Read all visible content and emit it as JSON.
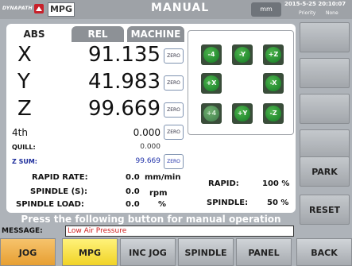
{
  "topbar": {
    "logo_text": "DYNAPATH",
    "mode_button": "MPG",
    "title": "MANUAL",
    "unit": "mm",
    "datetime": "2015-5-25 20:10:07",
    "priority": "Priority",
    "none": "None"
  },
  "tabs": {
    "abs": "ABS",
    "rel": "REL",
    "machine": "MACHINE"
  },
  "axes": {
    "x": {
      "label": "X",
      "value": "91.135"
    },
    "y": {
      "label": "Y",
      "value": "41.983"
    },
    "z": {
      "label": "Z",
      "value": "99.669"
    },
    "fourth": {
      "label": "4th",
      "value": "0.000"
    },
    "quill": {
      "label": "QUILL:",
      "value": "0.000"
    },
    "zsum": {
      "label": "Z SUM:",
      "value": "99.669"
    }
  },
  "zero_label": "ZERO",
  "rates": {
    "rapid_rate_label": "RAPID RATE:",
    "rapid_rate_value": "0.0",
    "rapid_rate_unit": "mm/min",
    "spindle_s_label": "SPINDLE (S):",
    "spindle_s_value": "0.0",
    "spindle_s_unit": "rpm",
    "spindle_load_label": "SPINDLE LOAD:",
    "spindle_load_value": "0.0",
    "spindle_load_unit": "%",
    "rapid_label": "RAPID:",
    "rapid_value": "100 %",
    "spindle_label": "SPINDLE:",
    "spindle_value": "50 %"
  },
  "jog_buttons": {
    "minus4": "-4",
    "minusY": "-Y",
    "plusZ": "+Z",
    "plusX": "+X",
    "minusX": "-X",
    "plus4": "+4",
    "plusY": "+Y",
    "minusZ": "-Z"
  },
  "prompt": "Press the following button for manual operation",
  "message": {
    "label": "MESSAGE:",
    "text": "Low Air Pressure"
  },
  "right_buttons": {
    "park": "PARK",
    "reset": "RESET",
    "back": "BACK"
  },
  "bottom_buttons": {
    "jog": "JOG",
    "mpg": "MPG",
    "inc_jog": "INC JOG",
    "spindle": "SPINDLE",
    "panel": "PANEL"
  },
  "colors": {
    "background": "#aeb3b9",
    "jog_green": "#137a23",
    "message_text": "#d02020",
    "jog_button": "#f6c36c",
    "mpg_button": "#fff27a"
  }
}
